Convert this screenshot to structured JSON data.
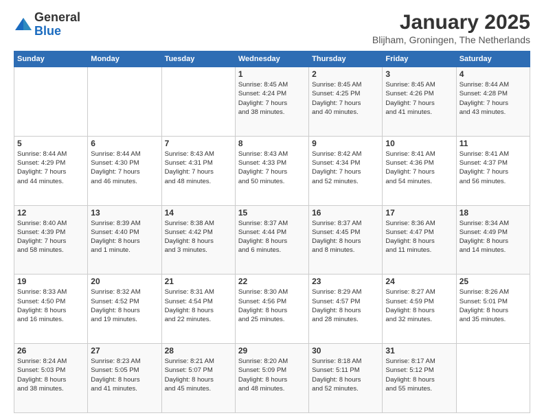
{
  "header": {
    "logo_general": "General",
    "logo_blue": "Blue",
    "month_title": "January 2025",
    "location": "Blijham, Groningen, The Netherlands"
  },
  "days_of_week": [
    "Sunday",
    "Monday",
    "Tuesday",
    "Wednesday",
    "Thursday",
    "Friday",
    "Saturday"
  ],
  "weeks": [
    [
      {
        "day": "",
        "info": ""
      },
      {
        "day": "",
        "info": ""
      },
      {
        "day": "",
        "info": ""
      },
      {
        "day": "1",
        "info": "Sunrise: 8:45 AM\nSunset: 4:24 PM\nDaylight: 7 hours\nand 38 minutes."
      },
      {
        "day": "2",
        "info": "Sunrise: 8:45 AM\nSunset: 4:25 PM\nDaylight: 7 hours\nand 40 minutes."
      },
      {
        "day": "3",
        "info": "Sunrise: 8:45 AM\nSunset: 4:26 PM\nDaylight: 7 hours\nand 41 minutes."
      },
      {
        "day": "4",
        "info": "Sunrise: 8:44 AM\nSunset: 4:28 PM\nDaylight: 7 hours\nand 43 minutes."
      }
    ],
    [
      {
        "day": "5",
        "info": "Sunrise: 8:44 AM\nSunset: 4:29 PM\nDaylight: 7 hours\nand 44 minutes."
      },
      {
        "day": "6",
        "info": "Sunrise: 8:44 AM\nSunset: 4:30 PM\nDaylight: 7 hours\nand 46 minutes."
      },
      {
        "day": "7",
        "info": "Sunrise: 8:43 AM\nSunset: 4:31 PM\nDaylight: 7 hours\nand 48 minutes."
      },
      {
        "day": "8",
        "info": "Sunrise: 8:43 AM\nSunset: 4:33 PM\nDaylight: 7 hours\nand 50 minutes."
      },
      {
        "day": "9",
        "info": "Sunrise: 8:42 AM\nSunset: 4:34 PM\nDaylight: 7 hours\nand 52 minutes."
      },
      {
        "day": "10",
        "info": "Sunrise: 8:41 AM\nSunset: 4:36 PM\nDaylight: 7 hours\nand 54 minutes."
      },
      {
        "day": "11",
        "info": "Sunrise: 8:41 AM\nSunset: 4:37 PM\nDaylight: 7 hours\nand 56 minutes."
      }
    ],
    [
      {
        "day": "12",
        "info": "Sunrise: 8:40 AM\nSunset: 4:39 PM\nDaylight: 7 hours\nand 58 minutes."
      },
      {
        "day": "13",
        "info": "Sunrise: 8:39 AM\nSunset: 4:40 PM\nDaylight: 8 hours\nand 1 minute."
      },
      {
        "day": "14",
        "info": "Sunrise: 8:38 AM\nSunset: 4:42 PM\nDaylight: 8 hours\nand 3 minutes."
      },
      {
        "day": "15",
        "info": "Sunrise: 8:37 AM\nSunset: 4:44 PM\nDaylight: 8 hours\nand 6 minutes."
      },
      {
        "day": "16",
        "info": "Sunrise: 8:37 AM\nSunset: 4:45 PM\nDaylight: 8 hours\nand 8 minutes."
      },
      {
        "day": "17",
        "info": "Sunrise: 8:36 AM\nSunset: 4:47 PM\nDaylight: 8 hours\nand 11 minutes."
      },
      {
        "day": "18",
        "info": "Sunrise: 8:34 AM\nSunset: 4:49 PM\nDaylight: 8 hours\nand 14 minutes."
      }
    ],
    [
      {
        "day": "19",
        "info": "Sunrise: 8:33 AM\nSunset: 4:50 PM\nDaylight: 8 hours\nand 16 minutes."
      },
      {
        "day": "20",
        "info": "Sunrise: 8:32 AM\nSunset: 4:52 PM\nDaylight: 8 hours\nand 19 minutes."
      },
      {
        "day": "21",
        "info": "Sunrise: 8:31 AM\nSunset: 4:54 PM\nDaylight: 8 hours\nand 22 minutes."
      },
      {
        "day": "22",
        "info": "Sunrise: 8:30 AM\nSunset: 4:56 PM\nDaylight: 8 hours\nand 25 minutes."
      },
      {
        "day": "23",
        "info": "Sunrise: 8:29 AM\nSunset: 4:57 PM\nDaylight: 8 hours\nand 28 minutes."
      },
      {
        "day": "24",
        "info": "Sunrise: 8:27 AM\nSunset: 4:59 PM\nDaylight: 8 hours\nand 32 minutes."
      },
      {
        "day": "25",
        "info": "Sunrise: 8:26 AM\nSunset: 5:01 PM\nDaylight: 8 hours\nand 35 minutes."
      }
    ],
    [
      {
        "day": "26",
        "info": "Sunrise: 8:24 AM\nSunset: 5:03 PM\nDaylight: 8 hours\nand 38 minutes."
      },
      {
        "day": "27",
        "info": "Sunrise: 8:23 AM\nSunset: 5:05 PM\nDaylight: 8 hours\nand 41 minutes."
      },
      {
        "day": "28",
        "info": "Sunrise: 8:21 AM\nSunset: 5:07 PM\nDaylight: 8 hours\nand 45 minutes."
      },
      {
        "day": "29",
        "info": "Sunrise: 8:20 AM\nSunset: 5:09 PM\nDaylight: 8 hours\nand 48 minutes."
      },
      {
        "day": "30",
        "info": "Sunrise: 8:18 AM\nSunset: 5:11 PM\nDaylight: 8 hours\nand 52 minutes."
      },
      {
        "day": "31",
        "info": "Sunrise: 8:17 AM\nSunset: 5:12 PM\nDaylight: 8 hours\nand 55 minutes."
      },
      {
        "day": "",
        "info": ""
      }
    ]
  ]
}
